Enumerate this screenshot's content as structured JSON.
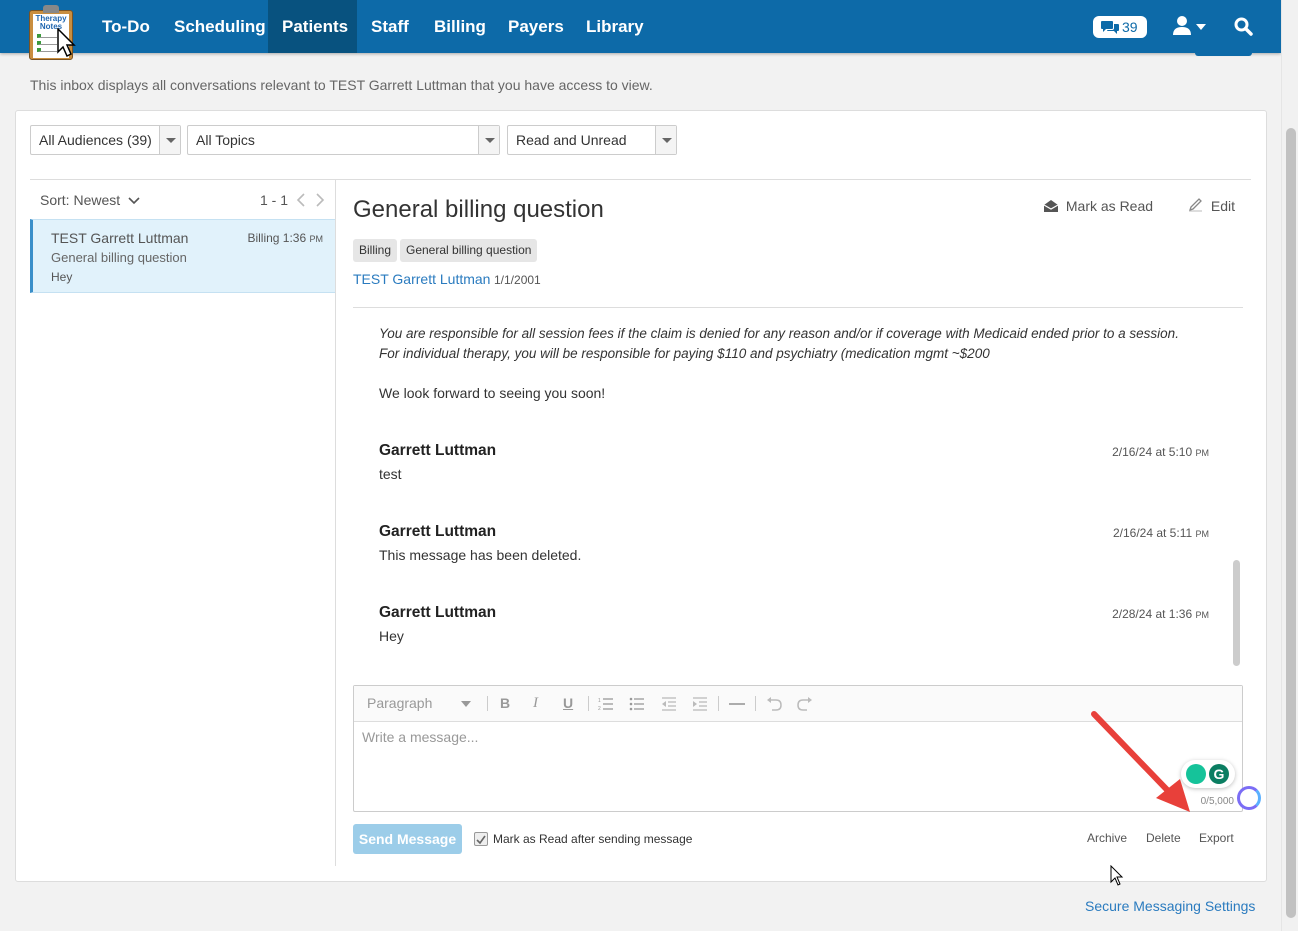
{
  "nav": {
    "logo_text": "Therapy Notes",
    "items": [
      {
        "label": "To-Do",
        "active": false
      },
      {
        "label": "Scheduling",
        "active": false
      },
      {
        "label": "Patients",
        "active": true
      },
      {
        "label": "Staff",
        "active": false
      },
      {
        "label": "Billing",
        "active": false
      },
      {
        "label": "Payers",
        "active": false
      },
      {
        "label": "Library",
        "active": false
      }
    ],
    "messages_count": "39",
    "accent_color": "#0d6aa8"
  },
  "intro_text": "This inbox displays all conversations relevant to TEST Garrett Luttman that you have access to view.",
  "filters": {
    "audience": "All Audiences (39)",
    "topic": "All Topics",
    "read_state": "Read and Unread"
  },
  "list": {
    "sort_label": "Sort: Newest",
    "pagination": "1 - 1",
    "conversations": [
      {
        "name": "TEST Garrett Luttman",
        "category": "Billing",
        "time": "1:36",
        "ampm": "PM",
        "subject": "General billing question",
        "preview": "Hey"
      }
    ]
  },
  "thread": {
    "subject": "General billing question",
    "mark_read_label": "Mark as Read",
    "edit_label": "Edit",
    "tags": [
      "Billing",
      "General billing question"
    ],
    "patient_name": "TEST Garrett Luttman",
    "patient_dob": "1/1/2001",
    "body_line1": "You are responsible for all session fees if the claim is denied for any reason and/or if coverage with Medicaid ended prior to a session.",
    "body_line2": "For individual therapy, you will be responsible for paying $110 and psychiatry (medication mgmt ~$200",
    "body_line3": "We look forward to seeing you soon!",
    "messages": [
      {
        "author": "Garrett Luttman",
        "date": "2/16/24 at 5:10",
        "ampm": "PM",
        "text": "test"
      },
      {
        "author": "Garrett Luttman",
        "date": "2/16/24 at 5:11",
        "ampm": "PM",
        "text": "This message has been deleted."
      },
      {
        "author": "Garrett Luttman",
        "date": "2/28/24 at 1:36",
        "ampm": "PM",
        "text": "Hey"
      }
    ]
  },
  "composer": {
    "format_select": "Paragraph",
    "placeholder": "Write a message...",
    "counter": "0/5,000",
    "send_label": "Send Message",
    "mark_read_after_label": "Mark as Read after sending message",
    "mark_read_after_checked": true,
    "archive_label": "Archive",
    "delete_label": "Delete",
    "export_label": "Export"
  },
  "settings_link": "Secure Messaging Settings"
}
